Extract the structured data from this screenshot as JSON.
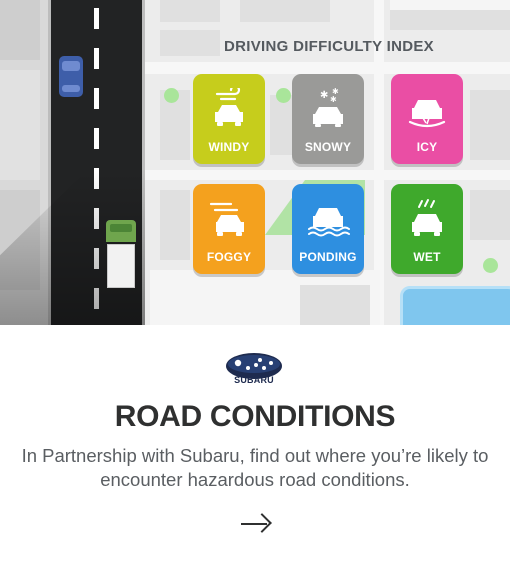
{
  "index": {
    "title": "DRIVING DIFFICULTY INDEX",
    "tiles": [
      {
        "label": "WINDY",
        "color": "#c6cd1c",
        "icon": "wind-car-icon"
      },
      {
        "label": "SNOWY",
        "color": "#9a9a98",
        "icon": "snow-car-icon"
      },
      {
        "label": "ICY",
        "color": "#ea4ea4",
        "icon": "ice-car-icon"
      },
      {
        "label": "FOGGY",
        "color": "#f4a11e",
        "icon": "fog-car-icon"
      },
      {
        "label": "PONDING",
        "color": "#2e8fe0",
        "icon": "ponding-car-icon"
      },
      {
        "label": "WET",
        "color": "#3fa92c",
        "icon": "rain-car-icon"
      }
    ]
  },
  "sponsor": {
    "name": "SUBARU",
    "logo_color": "#1e2b4f"
  },
  "article": {
    "headline": "ROAD CONDITIONS",
    "description": "In Partnership with Subaru, find out where you’re likely to encounter hazardous road conditions."
  },
  "cta": {
    "icon": "arrow-right-icon"
  }
}
